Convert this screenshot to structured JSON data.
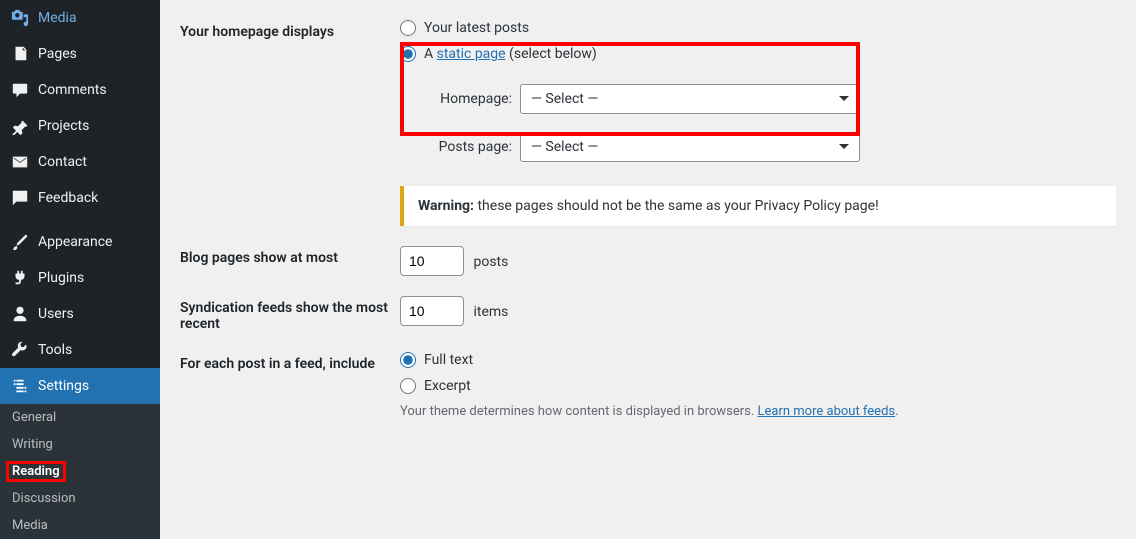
{
  "sidebar": {
    "items": [
      {
        "label": "Media"
      },
      {
        "label": "Pages"
      },
      {
        "label": "Comments"
      },
      {
        "label": "Projects"
      },
      {
        "label": "Contact"
      },
      {
        "label": "Feedback"
      },
      {
        "label": "Appearance"
      },
      {
        "label": "Plugins"
      },
      {
        "label": "Users"
      },
      {
        "label": "Tools"
      },
      {
        "label": "Settings"
      }
    ],
    "sub": [
      {
        "label": "General"
      },
      {
        "label": "Writing"
      },
      {
        "label": "Reading"
      },
      {
        "label": "Discussion"
      },
      {
        "label": "Media"
      }
    ]
  },
  "form": {
    "homepage": {
      "label": "Your homepage displays",
      "opt1": "Your latest posts",
      "opt2_pre": "A ",
      "opt2_link": "static page",
      "opt2_post": " (select below)",
      "homepage_label": "Homepage:",
      "posts_label": "Posts page:",
      "select_placeholder": "— Select —"
    },
    "warning": {
      "strong": "Warning:",
      "text": " these pages should not be the same as your Privacy Policy page!"
    },
    "blog": {
      "label": "Blog pages show at most",
      "value": "10",
      "suffix": "posts"
    },
    "feeds": {
      "label": "Syndication feeds show the most recent",
      "value": "10",
      "suffix": "items"
    },
    "post": {
      "label": "For each post in a feed, include",
      "opt1": "Full text",
      "opt2": "Excerpt",
      "desc_pre": "Your theme determines how content is displayed in browsers. ",
      "desc_link": "Learn more about feeds"
    }
  }
}
